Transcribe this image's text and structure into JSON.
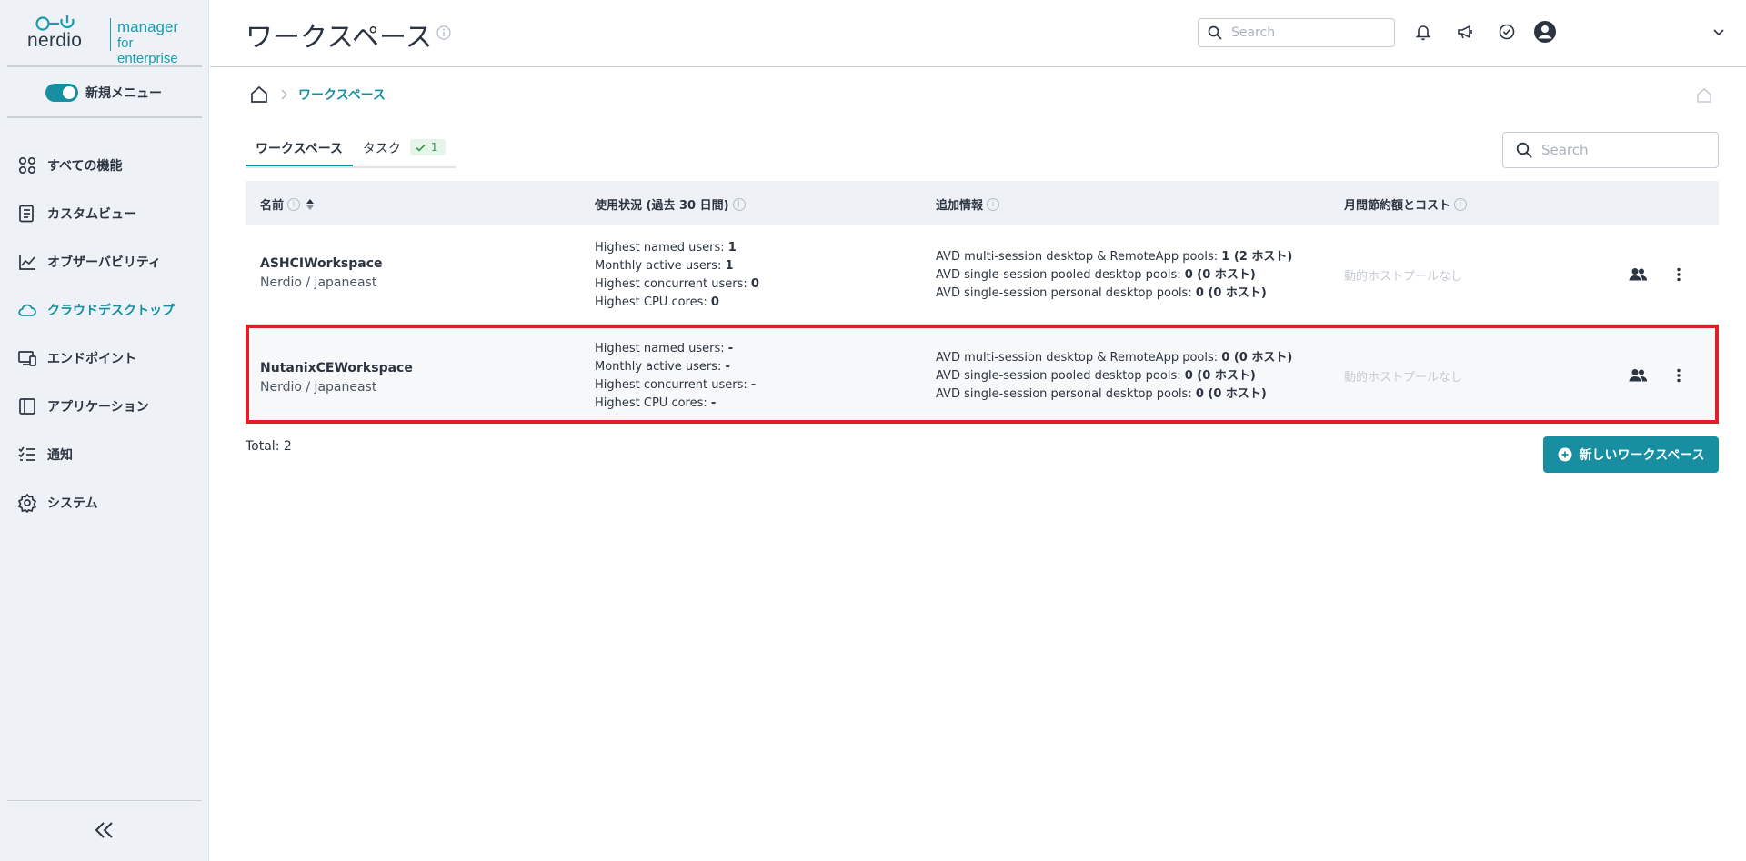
{
  "brand": {
    "word": "nerdio",
    "tag_line1": "manager",
    "tag_line2": "for enterprise"
  },
  "sidebar": {
    "toggle_label": "新規メニュー",
    "items": [
      {
        "label": "すべての機能",
        "icon": "grid-icon"
      },
      {
        "label": "カスタムビュー",
        "icon": "document-icon"
      },
      {
        "label": "オブザーバビリティ",
        "icon": "chart-line-icon"
      },
      {
        "label": "クラウドデスクトップ",
        "icon": "cloud-icon",
        "active": true
      },
      {
        "label": "エンドポイント",
        "icon": "devices-icon"
      },
      {
        "label": "アプリケーション",
        "icon": "app-window-icon"
      },
      {
        "label": "通知",
        "icon": "checklist-icon"
      },
      {
        "label": "システム",
        "icon": "gear-icon"
      }
    ]
  },
  "header": {
    "title": "ワークスペース",
    "search_placeholder": "Search"
  },
  "breadcrumb": {
    "current": "ワークスペース"
  },
  "tabs": [
    {
      "label": "ワークスペース",
      "active": true
    },
    {
      "label": "タスク",
      "badge": "1"
    }
  ],
  "table_search_placeholder": "Search",
  "table": {
    "headers": {
      "name": "名前",
      "usage": "使用状況 (過去 30 日間)",
      "info": "追加情報",
      "cost": "月間節約額とコスト"
    },
    "rows": [
      {
        "name": "ASHCIWorkspace",
        "location": "Nerdio / japaneast",
        "usage": [
          {
            "label": "Highest named users: ",
            "value": "1"
          },
          {
            "label": "Monthly active users: ",
            "value": "1"
          },
          {
            "label": "Highest concurrent users: ",
            "value": "0"
          },
          {
            "label": "Highest CPU cores: ",
            "value": "0"
          }
        ],
        "info": [
          {
            "label": "AVD multi-session desktop & RemoteApp pools: ",
            "value": "1 (2 ホスト)"
          },
          {
            "label": "AVD single-session pooled desktop pools: ",
            "value": "0 (0 ホスト)"
          },
          {
            "label": "AVD single-session personal desktop pools: ",
            "value": "0 (0 ホスト)"
          }
        ],
        "cost": "動的ホストプールなし"
      },
      {
        "name": "NutanixCEWorkspace",
        "location": "Nerdio / japaneast",
        "usage": [
          {
            "label": "Highest named users: ",
            "value": "-"
          },
          {
            "label": "Monthly active users: ",
            "value": "-"
          },
          {
            "label": "Highest concurrent users: ",
            "value": "-"
          },
          {
            "label": "Highest CPU cores: ",
            "value": "-"
          }
        ],
        "info": [
          {
            "label": "AVD multi-session desktop & RemoteApp pools: ",
            "value": "0 (0 ホスト)"
          },
          {
            "label": "AVD single-session pooled desktop pools: ",
            "value": "0 (0 ホスト)"
          },
          {
            "label": "AVD single-session personal desktop pools: ",
            "value": "0 (0 ホスト)"
          }
        ],
        "cost": "動的ホストプールなし",
        "highlighted": true
      }
    ]
  },
  "total_label": "Total: 2",
  "new_button_label": "新しいワークスペース",
  "colors": {
    "accent": "#178fa0",
    "highlight_border": "#e01e2a",
    "sidebar_bg": "#eef2f6"
  }
}
